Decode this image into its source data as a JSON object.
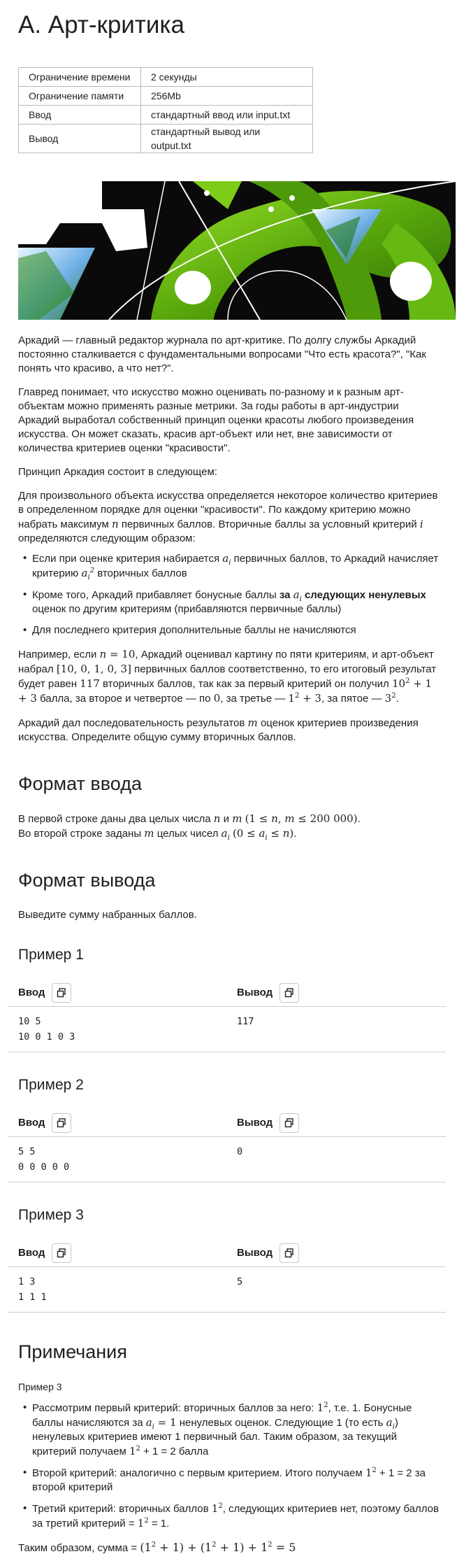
{
  "title": "A. Арт-критика",
  "limits": [
    {
      "key": "Ограничение времени",
      "value": "2 секунды"
    },
    {
      "key": "Ограничение памяти",
      "value": "256Mb"
    },
    {
      "key": "Ввод",
      "value": "стандартный ввод или input.txt"
    },
    {
      "key": "Вывод",
      "value": "стандартный вывод или output.txt"
    }
  ],
  "statement": {
    "p1": "Аркадий — главный редактор журнала по арт-критике. По долгу службы Аркадий постоянно сталкивается с фундаментальными вопросами \"Что есть красота?\", \"Как понять что красиво, а что нет?\".",
    "p2": "Главред понимает, что искусство можно оценивать по-разному и к разным арт-объектам можно применять разные метрики. За годы работы в арт-индустрии Аркадий выработал собственный принцип оценки красоты любого произведения искусства. Он может сказать, красив арт-объект или нет, вне зависимости от количества критериев оценки \"красивости\".",
    "p3": "Принцип Аркадия состоит в следующем:",
    "p4_a": "Для произвольного объекта искусства определяется некоторое количество критериев в определенном порядке для оценки \"красивости\". По каждому критерию можно набрать максимум",
    "p4_b": "первичных баллов. Вторичные баллы за условный критерий",
    "p4_c": "определяются следующим образом:",
    "b1_a": "Если при оценке критерия набирается",
    "b1_b": "первичных баллов, то Аркадий начисляет критерию",
    "b1_c": "вторичных баллов",
    "b2_a": "Кроме того, Аркадий прибавляет бонусные баллы",
    "b2_bold_a": "за",
    "b2_bold_b": "следующих ненулевых",
    "b2_c": "оценок по другим критериям (прибавляются первичные баллы)",
    "b3": "Для последнего критерия дополнительные баллы не начисляются",
    "p5_a": "Например, если",
    "p5_b": ", Аркадий оценивал картину по пяти критериям, и арт-объект набрал",
    "p5_c": "первичных баллов соответственно, то его итоговый результат будет равен",
    "p5_d": "вторичных баллов, так как за первый критерий он получил",
    "p5_e": "балла, за второе и четвертое — по",
    "p5_f": ", за третье —",
    "p5_g": ", за пятое —",
    "p6_a": "Аркадий дал последовательность результатов",
    "p6_b": "оценок критериев произведения искусства. Определите общую сумму вторичных баллов."
  },
  "input_format": {
    "heading": "Формат ввода",
    "l1_a": "В первой строке даны два целых числа",
    "l1_b": "и",
    "l2_a": "Во второй строке заданы",
    "l2_b": "целых чисел"
  },
  "output_format": {
    "heading": "Формат вывода",
    "text": "Выведите сумму набранных баллов."
  },
  "samples": [
    {
      "title": "Пример 1",
      "input_label": "Ввод",
      "output_label": "Вывод",
      "input": "10 5\n10 0 1 0 3",
      "output": "117"
    },
    {
      "title": "Пример 2",
      "input_label": "Ввод",
      "output_label": "Вывод",
      "input": "5 5\n0 0 0 0 0",
      "output": "0"
    },
    {
      "title": "Пример 3",
      "input_label": "Ввод",
      "output_label": "Вывод",
      "input": "1 3\n1 1 1",
      "output": "5"
    }
  ],
  "notes": {
    "heading": "Примечания",
    "sub": "Пример 3",
    "n1_a": "Рассмотрим первый критерий: вторичных баллов за него:",
    "n1_b": ", т.е. 1. Бонусные баллы начисляются за",
    "n1_c": "ненулевых оценок. Следующие 1 (то есть",
    "n1_d": ") ненулевых критериев имеют 1 первичный бал. Таким образом, за текущий критерий получаем",
    "n1_e": "+ 1 = 2 балла",
    "n2_a": "Второй критерий: аналогично с первым критерием. Итого получаем",
    "n2_b": "+ 1 = 2 за второй критерий",
    "n3_a": "Третий критерий: вторичных баллов",
    "n3_b": ", следующих критериев нет, поэтому баллов за третий критерий =",
    "n3_c": "= 1.",
    "sum_a": "Таким образом, сумма ="
  },
  "colors": {
    "banner_green": "#6fbf12",
    "banner_dark": "#0a0a0a",
    "border": "#b9b9b9"
  },
  "icons": {
    "copy": "copy-icon"
  }
}
